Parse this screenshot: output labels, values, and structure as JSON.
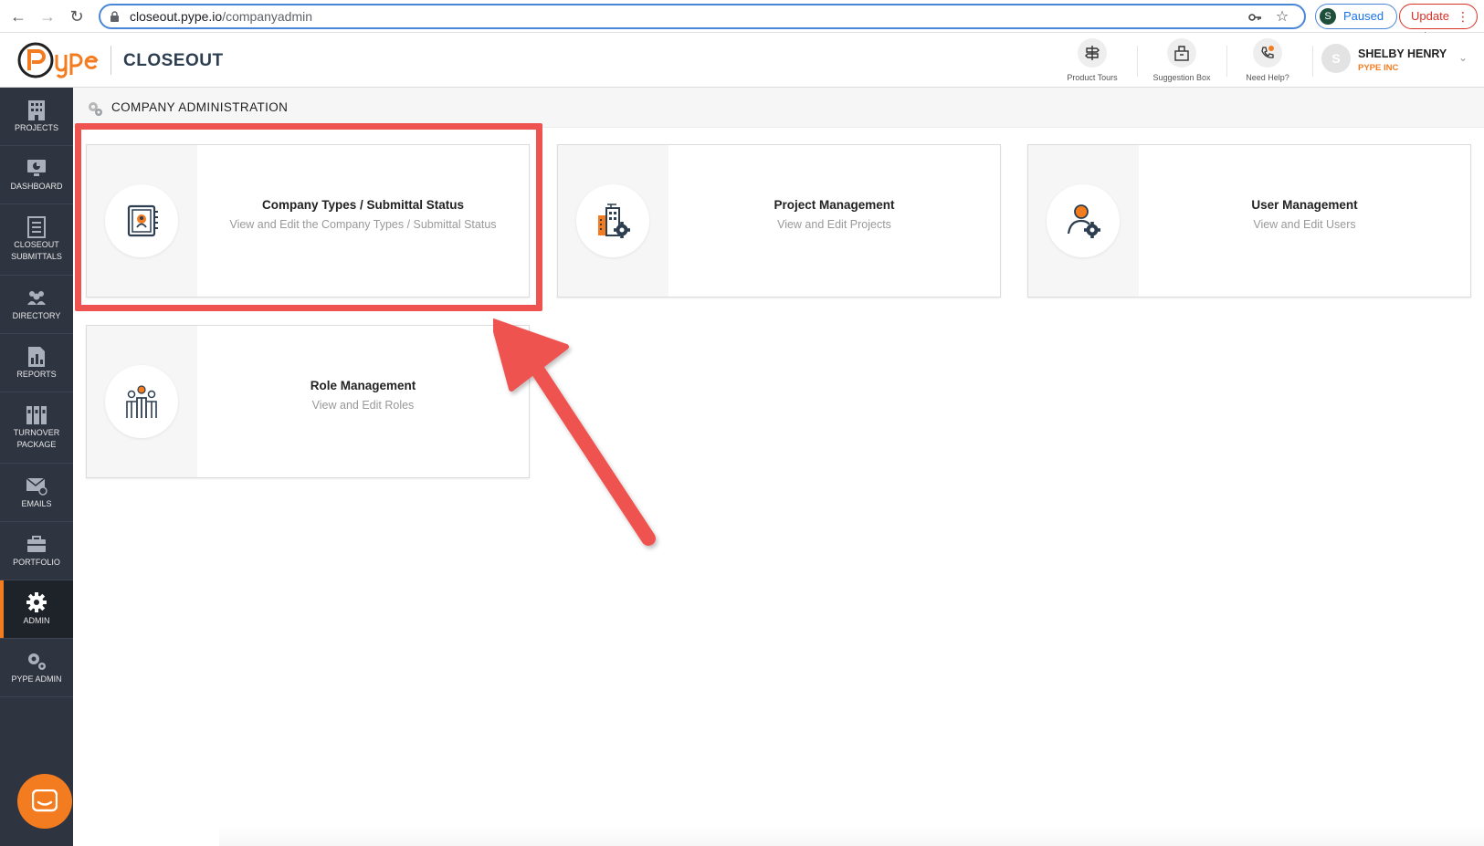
{
  "browser": {
    "url_host": "closeout.pype.io",
    "url_path": "/companyadmin",
    "profile_initial": "S",
    "profile_status": "Paused",
    "update_label": "Update"
  },
  "header": {
    "product_name": "CLOSEOUT",
    "tools": [
      {
        "label": "Product Tours"
      },
      {
        "label": "Suggestion Box"
      },
      {
        "label": "Need Help?"
      }
    ],
    "user": {
      "initial": "S",
      "name": "SHELBY HENRY",
      "org": "PYPE INC"
    }
  },
  "sidebar": {
    "items": [
      {
        "label": "PROJECTS"
      },
      {
        "label": "DASHBOARD"
      },
      {
        "label": "CLOSEOUT SUBMITTALS"
      },
      {
        "label": "DIRECTORY"
      },
      {
        "label": "REPORTS"
      },
      {
        "label": "TURNOVER PACKAGE"
      },
      {
        "label": "EMAILS"
      },
      {
        "label": "PORTFOLIO"
      },
      {
        "label": "ADMIN"
      },
      {
        "label": "PYPE ADMIN"
      }
    ],
    "active": "ADMIN"
  },
  "page": {
    "title": "COMPANY ADMINISTRATION",
    "cards": [
      {
        "title": "Company Types / Submittal Status",
        "subtitle": "View and Edit the Company Types / Submittal Status"
      },
      {
        "title": "Project Management",
        "subtitle": "View and Edit Projects"
      },
      {
        "title": "User Management",
        "subtitle": "View and Edit Users"
      },
      {
        "title": "Role Management",
        "subtitle": "View and Edit Roles"
      }
    ]
  },
  "colors": {
    "accent": "#f47c20",
    "sidebar_bg": "#2e3440",
    "highlight": "#ef5350"
  }
}
